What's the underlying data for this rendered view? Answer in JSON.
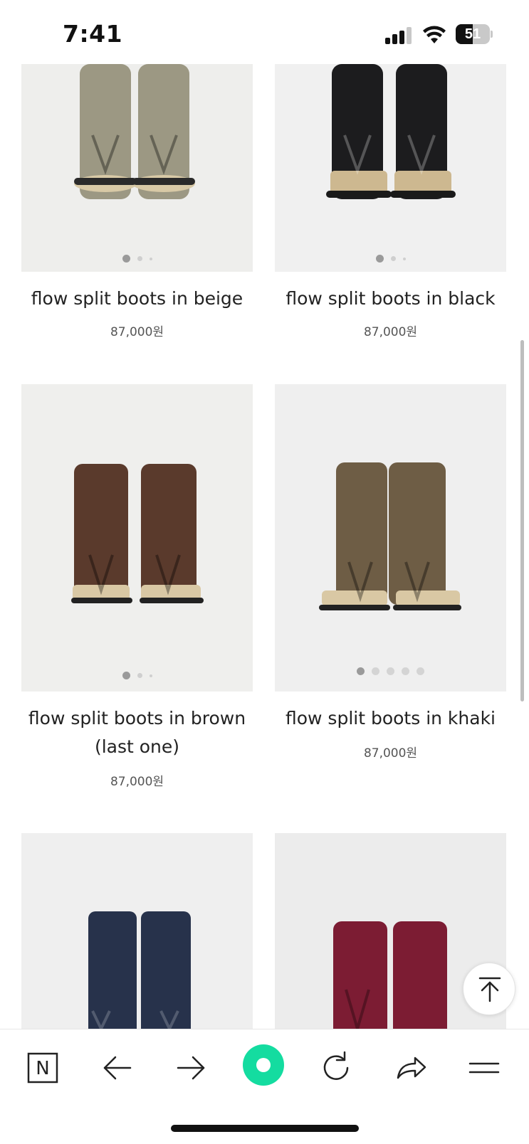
{
  "status_bar": {
    "time": "7:41",
    "battery": "51",
    "battery_level": 0.51,
    "signal_bars_active": 3
  },
  "products": [
    {
      "name": "flow split boots in beige",
      "price": "87,000원",
      "color": "#9c9883",
      "image_dots": 3,
      "active_dot": 0
    },
    {
      "name": "flow split boots in black",
      "price": "87,000원",
      "color": "#1c1c1e",
      "image_dots": 3,
      "active_dot": 0
    },
    {
      "name": "flow split boots in brown\n(last one)",
      "price": "87,000원",
      "color": "#5a3a2c",
      "image_dots": 3,
      "active_dot": 0
    },
    {
      "name": "flow split boots in khaki",
      "price": "87,000원",
      "color": "#6e5d45",
      "image_dots": 5,
      "active_dot": 0
    },
    {
      "name": "",
      "price": "",
      "color": "#27324b"
    },
    {
      "name": "",
      "price": "",
      "color": "#7c1c33"
    }
  ],
  "toolbar": {
    "icons": [
      "naver-n-icon",
      "back-arrow-icon",
      "forward-arrow-icon",
      "green-dot-icon",
      "reload-icon",
      "share-icon",
      "menu-icon"
    ],
    "green_color": "#14dca0"
  }
}
